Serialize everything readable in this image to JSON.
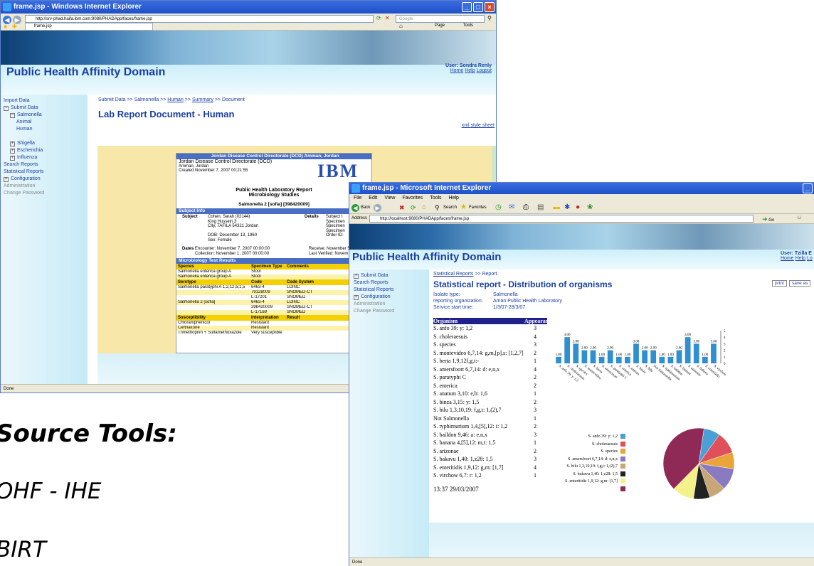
{
  "colors": {
    "accent": "#1a3fa0",
    "ie_blue": "#2a5bd6",
    "doc_section": "#4a6ec4",
    "yellow": "#f4d000"
  },
  "slide": {
    "heading": "Source Tools:",
    "bullets": [
      "OHF - IHE",
      "BIRT"
    ]
  },
  "win1": {
    "title": "frame.jsp - Windows Internet Explorer",
    "address": "http://srv-phad.haifa.ibm.com:9080/PHADApp/faces/frame.jsp",
    "search_placeholder": "Google",
    "tab": "frame.jsp",
    "toolbar_right": [
      "Page",
      "Tools"
    ],
    "status": "Done",
    "app_title": "Public Health Affinity Domain",
    "user": "User: Sondra Renly",
    "user_links": [
      "Home",
      "Help",
      "Logout"
    ],
    "sidebar": [
      {
        "label": "Import Data",
        "grey": false,
        "indent": 0
      },
      {
        "label": "Submit Data",
        "grey": false,
        "indent": 0,
        "expander": "−"
      },
      {
        "label": "Salmonella",
        "grey": false,
        "indent": 1,
        "expander": "−"
      },
      {
        "label": "Animal",
        "grey": false,
        "indent": 2
      },
      {
        "label": "Human",
        "grey": false,
        "indent": 2
      },
      {
        "label": "",
        "grey": false,
        "indent": 0
      },
      {
        "label": "Shigella",
        "grey": false,
        "indent": 1,
        "expander": "+"
      },
      {
        "label": "Escherichia",
        "grey": false,
        "indent": 1,
        "expander": "+"
      },
      {
        "label": "Influenza",
        "grey": false,
        "indent": 1,
        "expander": "+"
      },
      {
        "label": "Search Reports",
        "grey": false,
        "indent": 0
      },
      {
        "label": "Statistical Reports",
        "grey": false,
        "indent": 0
      },
      {
        "label": "Configuration",
        "grey": false,
        "indent": 0,
        "expander": "+"
      },
      {
        "label": "Administration",
        "grey": true,
        "indent": 0
      },
      {
        "label": "Change Password",
        "grey": true,
        "indent": 0
      }
    ],
    "breadcrumb": {
      "a": "Submit Data >> Salmonella >> ",
      "b": "Human",
      "c": " >> ",
      "d": "Summary",
      "e": " >> Document"
    },
    "page_title": "Lab Report Document - Human",
    "xml_link": "xml style sheet",
    "doc": {
      "org_header": "Jordan Disease Control Directorate (DCD) Amman, Jordan",
      "org_lines": [
        "Jordan Disease Control Directorate (DCD)",
        "Amman, Jordan",
        "Created November 7, 2007 00:21:55"
      ],
      "logo": "IBM",
      "report_title": "Public Health Laboratory Report",
      "report_subtitle": "Microbiology Studies",
      "specimen": "Salmonella 2 [sofia] [398420009]",
      "subject_info_label": "Subject Info",
      "subject_label": "Subject",
      "subject_lines": [
        "Cohen, Sarah (02144)",
        "King Hussein 3",
        "City, TAFILA 54321 Jordan",
        "",
        "DOB: December 13, 1960",
        "Sex: Female"
      ],
      "details_label": "Details",
      "details_lines": [
        "Subject I",
        "Specimen",
        "Specimen",
        "Specimen",
        "Order ID:"
      ],
      "dates_label": "Dates",
      "dates_lines": [
        "Encounter: November 7, 2007 00:00:00",
        "Collection: November 1, 2007 00:00:00"
      ],
      "dates_right": [
        "Receive: November 5",
        "Last Verified: Novem"
      ],
      "micro_label": "Microbiology Test Results",
      "species_headers": [
        "Species",
        "Specimen Type",
        "Comments"
      ],
      "species_rows": [
        [
          "Salmonella enterica group A",
          "Stool",
          ""
        ],
        [
          "Salmonella enterica group A",
          "Stool",
          ""
        ]
      ],
      "serotype_headers": [
        "Serotype",
        "Code",
        "Code System"
      ],
      "serotype_rows": [
        [
          "Salmonella paratyphi A 1,2,12;a;1,5",
          "6463-4",
          "LOINC"
        ],
        [
          "",
          "79128009",
          "SNOMED-CT"
        ],
        [
          "",
          "L-17201",
          "SNOMED"
        ],
        [
          "Salmonella 2 [sofia]",
          "6463-4",
          "LOINC"
        ],
        [
          "",
          "398420009",
          "SNOMED-CT"
        ],
        [
          "",
          "L-17169",
          "SNOMED"
        ]
      ],
      "susc_headers": [
        "Susceptibility",
        "Interpretation",
        "Result"
      ],
      "susc_rows": [
        [
          "Chloramphenicol",
          "Resistant",
          ""
        ],
        [
          "Ceftriaxone",
          "Resistant",
          ""
        ],
        [
          "Trimethoprim + Sulfamethoxazole",
          "Very susceptible",
          ""
        ]
      ]
    }
  },
  "win2": {
    "title": "frame.jsp - Microsoft Internet Explorer",
    "menu": [
      "File",
      "Edit",
      "View",
      "Favorites",
      "Tools",
      "Help"
    ],
    "back": "Back",
    "search": "Search",
    "favorites": "Favorites",
    "address_label": "Address",
    "address": "http://localhost:9080/PHADApp/faces/frame.jsp",
    "go": "Go",
    "links": "Li",
    "status": "Done",
    "app_title": "Public Health Affinity Domain",
    "user": "User: Tzilla E",
    "user_links": [
      "Home",
      "Help",
      "Lo"
    ],
    "sidebar": [
      {
        "label": "Submit Data",
        "grey": false,
        "expander": "+"
      },
      {
        "label": "Search Reports",
        "grey": false
      },
      {
        "label": "Statistical Reports",
        "grey": false
      },
      {
        "label": "Configuration",
        "grey": false,
        "expander": "+"
      },
      {
        "label": "Administration",
        "grey": true
      },
      {
        "label": "Change Password",
        "grey": true
      }
    ],
    "breadcrumb_link": "Statistical Reports",
    "breadcrumb_rest": " >> Report",
    "page_title": "Statistical report - Distribution of organisms",
    "print": "print",
    "save_as": "save as",
    "meta": [
      {
        "k": "Isolate type:",
        "v": "Salmonella"
      },
      {
        "k": "reporting organization:",
        "v": "Aman Public Health Laboratory"
      },
      {
        "k": "Service start time:",
        "v": "1/3/07-28/3/07"
      }
    ],
    "table_headers": [
      "Organism",
      "Appearances"
    ],
    "table_rows": [
      [
        "S. anfo 39: y: 1,2",
        "3"
      ],
      [
        "S. choleraesuis",
        "4"
      ],
      [
        "S. species",
        "3"
      ],
      [
        "S. montevideo 6,7,14: g,m,[p],s: [1,2,7]",
        "2"
      ],
      [
        "S. berta 1,9,12f,g,t:-",
        "1"
      ],
      [
        "S. amersfoort 6,7,14: d: e,n,x",
        "4"
      ],
      [
        "S. paratyphi C",
        "2"
      ],
      [
        "S. enterica",
        "2"
      ],
      [
        "S. anatum 3,10: e,h: 1,6",
        "1"
      ],
      [
        "S. binza 3,15: y: 1,5",
        "2"
      ],
      [
        "S. bilu 1,3,10,19: f,g,t: 1,(2),7",
        "3"
      ],
      [
        "Not Salmonella",
        "1"
      ],
      [
        "S. typhimurium 1,4,[5],12: i: 1,2",
        "2"
      ],
      [
        "S. baildon 9,46: a: e,n,x",
        "3"
      ],
      [
        "S. banana 4,[5],12: m,t: 1,5",
        "1"
      ],
      [
        "S. arizonae",
        "2"
      ],
      [
        "S. bakavu 1,40: 1,z28: 1,5",
        "3"
      ],
      [
        "S. enteritidis 1,9,12: g,m: [1,7]",
        "4"
      ],
      [
        "S. virchow 6,7: r: 1,2",
        "1"
      ]
    ],
    "timestamp": "13:37 29/03/2007"
  },
  "chart_data": [
    {
      "type": "bar",
      "categories": [
        "S. anfo 39: y: 1,2",
        "S. choleraesuis",
        "S. species",
        "S. montevideo",
        "S. berta",
        "S. amersfoort",
        "S. paratyphi C",
        "S. enterica",
        "S. anatum",
        "S. binza",
        "S. bilu",
        "Not Salmonella",
        "S. typhimurium",
        "S. baildon",
        "S. banana",
        "S. arizonae",
        "S. bakavu",
        "S. enteritidis",
        "S. virchow"
      ],
      "values": [
        1,
        4,
        3,
        2,
        2,
        1,
        2,
        1,
        1,
        3,
        2,
        2,
        1,
        1,
        2,
        4,
        3,
        1,
        3
      ],
      "value_labels": [
        "1.00",
        "4.00",
        "3.00",
        "2.00",
        "2.00",
        "1.00",
        "2.00",
        "1.00",
        "1.00",
        "3.00",
        "2.00",
        "2.00",
        "1.00",
        "1.00",
        "2.00",
        "4.00",
        "3.00",
        "1.00",
        "3.00"
      ],
      "yticks": [
        "0",
        "1",
        "2",
        "3",
        "4",
        "5"
      ],
      "ylim": [
        0,
        5
      ],
      "color": "#2f8fcf"
    },
    {
      "type": "pie",
      "legend": [
        {
          "label": "S. anfo 39: y: 1,2",
          "color": "#4a9fd6"
        },
        {
          "label": "S. choleraesuis",
          "color": "#e0505a"
        },
        {
          "label": "S. species",
          "color": "#e9a43a"
        },
        {
          "label": "S. amersfoort 6,7,14: d: e,n,x",
          "color": "#8a7ac0"
        },
        {
          "label": "S. bilu 1,3,10,19: f,g,t: 1,(2),7",
          "color": "#c8a676"
        },
        {
          "label": "S. bakavu 1,40: 1,z28: 1,5",
          "color": "#222222"
        },
        {
          "label": "S. enteritidis 1,9,12: g,m: [1,7]",
          "color": "#f4f08a"
        },
        {
          "label": "",
          "color": "#8e2a55"
        }
      ],
      "values": [
        3,
        4,
        3,
        4,
        3,
        3,
        4,
        16
      ]
    }
  ]
}
